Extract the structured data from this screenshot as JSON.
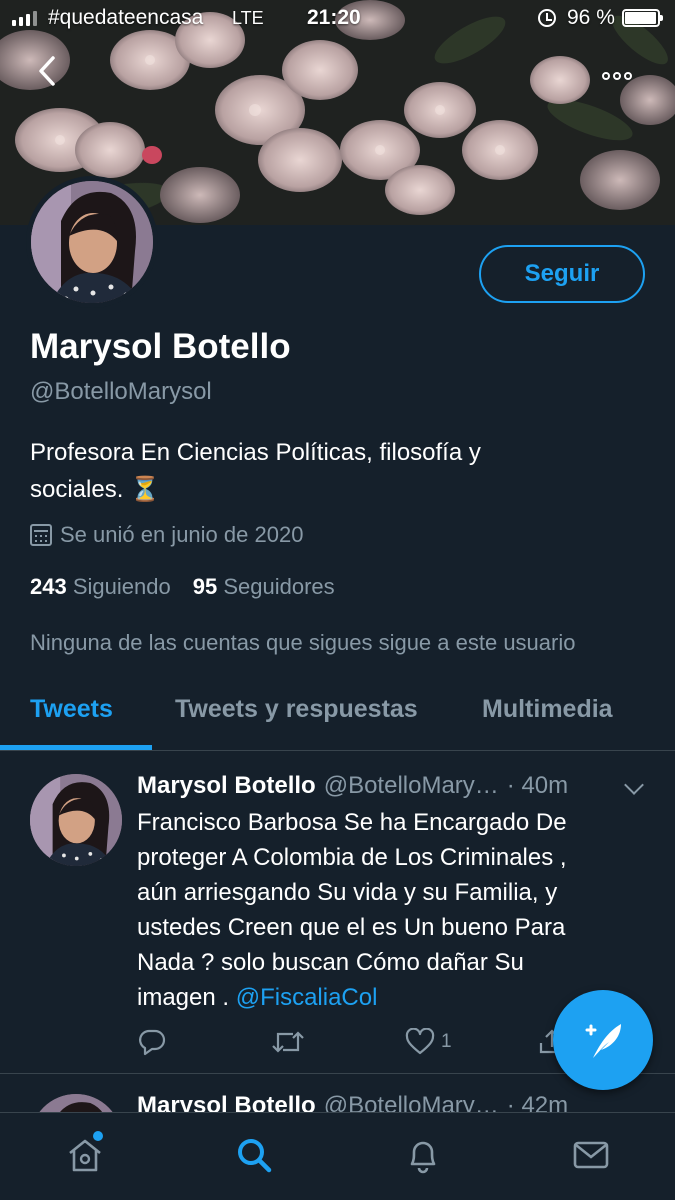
{
  "status_bar": {
    "carrier": "#quedateencasa",
    "network": "LTE",
    "time": "21:20",
    "battery_percent": "96 %",
    "battery_level": 0.96
  },
  "header": {
    "back_icon": "chevron-left-icon",
    "more_icon": "more-horizontal-icon"
  },
  "profile": {
    "name": "Marysol Botello",
    "handle": "@BotelloMarysol",
    "bio_line1": "Profesora En Ciencias Políticas, filosofía y",
    "bio_line2": "sociales. ⏳",
    "joined": "Se unió en junio de 2020",
    "following_count": "243",
    "following_label": "Siguiendo",
    "followers_count": "95",
    "followers_label": "Seguidores",
    "mutual_note": "Ninguna de las cuentas que sigues sigue a este usuario",
    "follow_button": "Seguir"
  },
  "tabs": [
    {
      "label": "Tweets",
      "active": true
    },
    {
      "label": "Tweets y respuestas",
      "active": false
    },
    {
      "label": "Multimedia",
      "active": false
    }
  ],
  "tweets": [
    {
      "name": "Marysol Botello",
      "handle": "@BotelloMary…",
      "time": "· 40m",
      "text_lines": [
        "Francisco Barbosa Se ha Encargado De",
        "proteger A Colombia de Los Criminales ,",
        "aún arriesgando Su vida y su Familia, y",
        "ustedes Creen que el es Un bueno Para",
        "Nada ? solo buscan Cómo dañar Su"
      ],
      "text_last_prefix": "imagen . ",
      "mention": "@FiscaliaCol",
      "like_count": "1"
    },
    {
      "name": "Marysol Botello",
      "handle": "@BotelloMary…",
      "time": "· 42m"
    }
  ],
  "colors": {
    "background": "#15202b",
    "accent": "#1da1f2",
    "secondary_text": "#8899a6",
    "divider": "#38444d"
  }
}
